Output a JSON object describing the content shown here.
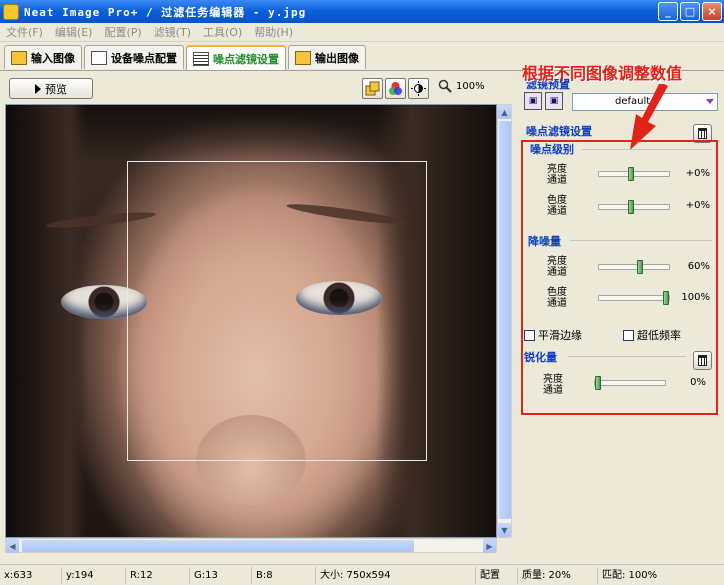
{
  "window": {
    "title": "Neat Image Pro+ / 过滤任务编辑器 - y.jpg",
    "buttons": [
      "_",
      "□",
      "×"
    ]
  },
  "menu": [
    "文件(F)",
    "编辑(E)",
    "配置(P)",
    "滤镜(T)",
    "工具(O)",
    "帮助(H)"
  ],
  "tabs": [
    {
      "label": "输入图像",
      "active": false
    },
    {
      "label": "设备噪点配置",
      "active": false
    },
    {
      "label": "噪点滤镜设置",
      "active": true
    },
    {
      "label": "输出图像",
      "active": false
    }
  ],
  "toolbar": {
    "preview_label": "预览",
    "zoom_value": "100%"
  },
  "annotation": "根据不同图像调整数值",
  "filter_presets": {
    "title": "滤镜预置",
    "selected": "default"
  },
  "noise_filter": {
    "title": "噪点滤镜设置",
    "noise_level": {
      "title": "噪点级别",
      "luminance": {
        "label": "亮度 通道",
        "value": "+0%",
        "level": 0.45
      },
      "chrominance": {
        "label": "色度 通道",
        "value": "+0%",
        "level": 0.45
      }
    },
    "noise_reduction": {
      "title": "降噪量",
      "luminance": {
        "label": "亮度 通道",
        "value": "60%",
        "level": 0.6
      },
      "chrominance": {
        "label": "色度 通道",
        "value": "100%",
        "level": 1.0
      }
    },
    "smooth_edges": "平滑边缘",
    "ultra_low_freq": "超低频率",
    "sharpening": {
      "title": "锐化量",
      "luminance": {
        "label": "亮度 通道",
        "value": "0%",
        "level": 0.0
      }
    }
  },
  "status": {
    "x": "x:633",
    "y": "y:194",
    "r": "R:12",
    "g": "G:13",
    "b": "B:8",
    "size": "大小: 750x594",
    "profile": "配置",
    "quality": "质量: 20%",
    "match": "匹配: 100%"
  }
}
